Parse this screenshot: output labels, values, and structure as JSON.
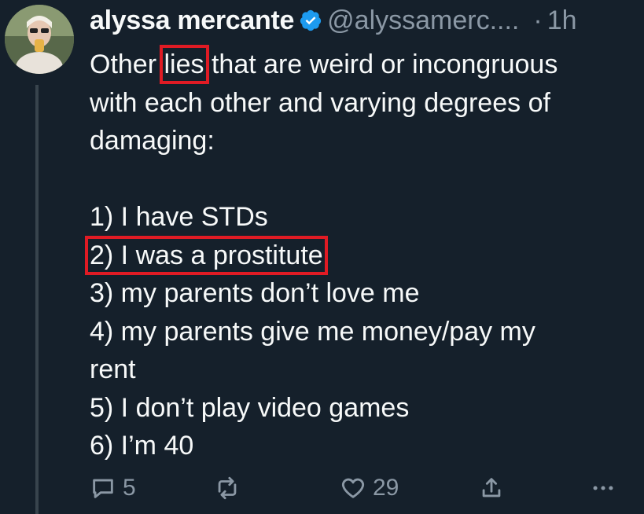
{
  "tweet": {
    "display_name": "alyssa mercante",
    "handle": "@alyssamerc....",
    "dot": "·",
    "time": "1h",
    "text": {
      "line1_before": "Other",
      "line1_highlight": "lies",
      "line1_after": "that are weird or incongruous",
      "line2": "with each other and varying degrees of",
      "line3": "damaging:",
      "items": [
        "1) I have STDs",
        "2) I was a prostitute",
        "3) my parents don’t love me",
        "4) my parents give me money/pay my",
        "rent",
        "5) I don’t play video games",
        "6) I’m 40"
      ]
    }
  },
  "actions": {
    "reply_count": "5",
    "retweet_count": "",
    "like_count": "29"
  },
  "colors": {
    "background": "#15202b",
    "text": "#f7f9f9",
    "muted": "#8b98a5",
    "verified": "#1d9bf0",
    "highlight_box": "#e01b24"
  }
}
